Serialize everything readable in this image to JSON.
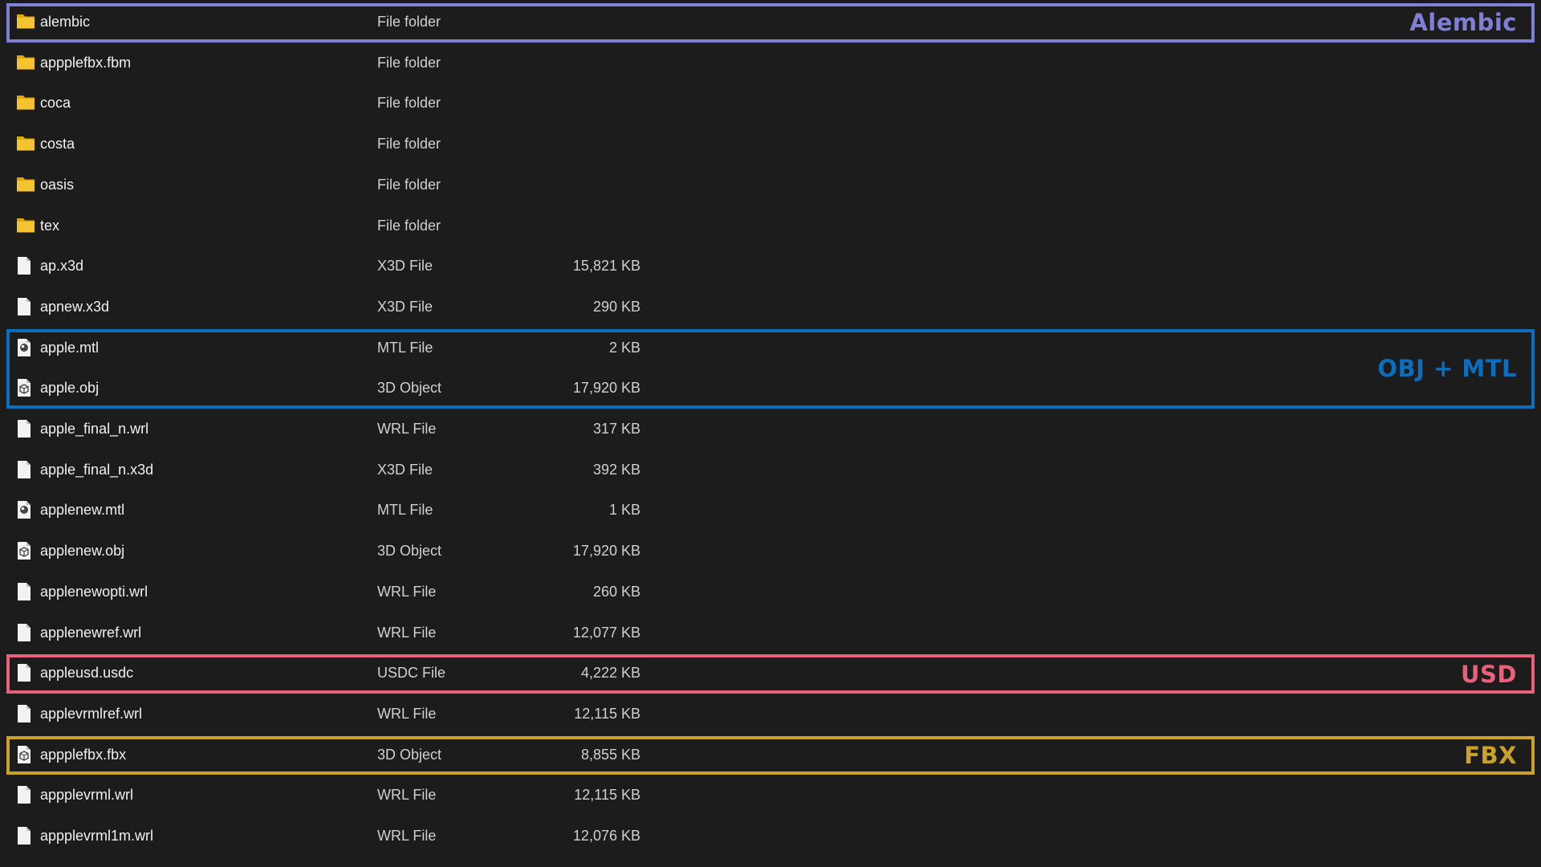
{
  "files": [
    {
      "name": "alembic",
      "type": "File folder",
      "size": "",
      "icon": "folder-icon"
    },
    {
      "name": "appplefbx.fbm",
      "type": "File folder",
      "size": "",
      "icon": "folder-icon"
    },
    {
      "name": "coca",
      "type": "File folder",
      "size": "",
      "icon": "folder-icon"
    },
    {
      "name": "costa",
      "type": "File folder",
      "size": "",
      "icon": "folder-icon"
    },
    {
      "name": "oasis",
      "type": "File folder",
      "size": "",
      "icon": "folder-icon"
    },
    {
      "name": "tex",
      "type": "File folder",
      "size": "",
      "icon": "folder-icon"
    },
    {
      "name": "ap.x3d",
      "type": "X3D File",
      "size": "15,821 KB",
      "icon": "file-icon"
    },
    {
      "name": "apnew.x3d",
      "type": "X3D File",
      "size": "290 KB",
      "icon": "file-icon"
    },
    {
      "name": "apple.mtl",
      "type": "MTL File",
      "size": "2 KB",
      "icon": "mtl-file-icon"
    },
    {
      "name": "apple.obj",
      "type": "3D Object",
      "size": "17,920 KB",
      "icon": "3d-object-icon"
    },
    {
      "name": "apple_final_n.wrl",
      "type": "WRL File",
      "size": "317 KB",
      "icon": "file-icon"
    },
    {
      "name": "apple_final_n.x3d",
      "type": "X3D File",
      "size": "392 KB",
      "icon": "file-icon"
    },
    {
      "name": "applenew.mtl",
      "type": "MTL File",
      "size": "1 KB",
      "icon": "mtl-file-icon"
    },
    {
      "name": "applenew.obj",
      "type": "3D Object",
      "size": "17,920 KB",
      "icon": "3d-object-icon"
    },
    {
      "name": "applenewopti.wrl",
      "type": "WRL File",
      "size": "260 KB",
      "icon": "file-icon"
    },
    {
      "name": "applenewref.wrl",
      "type": "WRL File",
      "size": "12,077 KB",
      "icon": "file-icon"
    },
    {
      "name": "appleusd.usdc",
      "type": "USDC File",
      "size": "4,222 KB",
      "icon": "file-icon"
    },
    {
      "name": "applevrmlref.wrl",
      "type": "WRL File",
      "size": "12,115 KB",
      "icon": "file-icon"
    },
    {
      "name": "appplefbx.fbx",
      "type": "3D Object",
      "size": "8,855 KB",
      "icon": "3d-object-icon"
    },
    {
      "name": "appplevrml.wrl",
      "type": "WRL File",
      "size": "12,115 KB",
      "icon": "file-icon"
    },
    {
      "name": "appplevrml1m.wrl",
      "type": "WRL File",
      "size": "12,076 KB",
      "icon": "file-icon"
    }
  ],
  "highlights": [
    {
      "label": "Alembic",
      "color": "#7f7fd5",
      "rows": [
        0,
        0
      ]
    },
    {
      "label": "OBJ + MTL",
      "color": "#0a6ebd",
      "rows": [
        8,
        9
      ]
    },
    {
      "label": "USD",
      "color": "#e8607a",
      "rows": [
        16,
        16
      ]
    },
    {
      "label": "FBX",
      "color": "#c9a227",
      "rows": [
        18,
        18
      ]
    }
  ],
  "colors": {
    "background": "#1c1c1c",
    "folder": "#f4c430",
    "file": "#e8e8e8"
  }
}
